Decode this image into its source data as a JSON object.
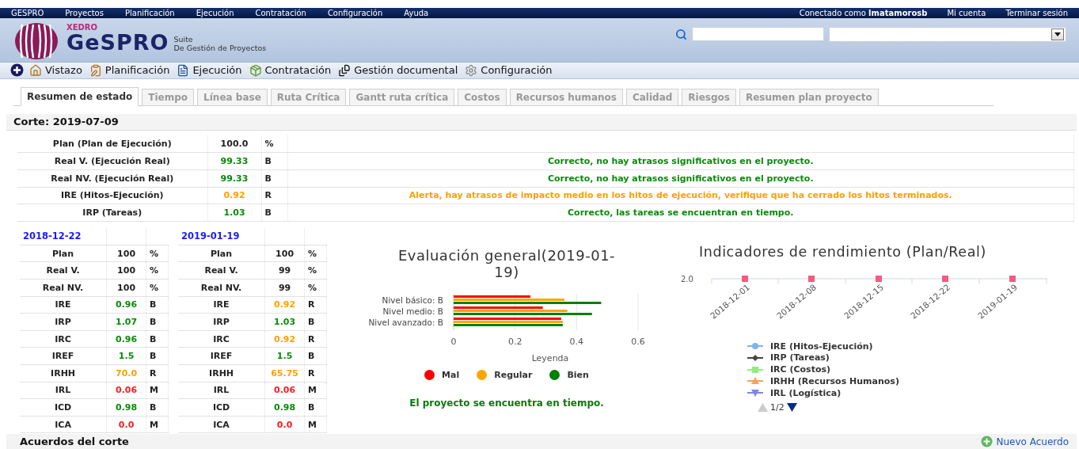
{
  "top_menu": {
    "items": [
      "GESPRO",
      "Proyectos",
      "Planificación",
      "Ejecución",
      "Contratación",
      "Configuración",
      "Ayuda"
    ],
    "user_prefix": "Conectado como",
    "user": "lmatamorosb",
    "links": [
      "Mi cuenta",
      "Terminar sesión"
    ]
  },
  "header": {
    "brand_small": "XEDRO",
    "brand": "GeSPRO",
    "suite": "Suite",
    "subtitle": "De Gestión de Proyectos"
  },
  "toolbar": [
    {
      "label": "Vistazo",
      "kind": "home"
    },
    {
      "label": "Planificación",
      "kind": "plan"
    },
    {
      "label": "Ejecución",
      "kind": "execution"
    },
    {
      "label": "Contratación",
      "kind": "contract"
    },
    {
      "label": "Gestión documental",
      "kind": "documents"
    },
    {
      "label": "Configuración",
      "kind": "settings"
    }
  ],
  "tabs": [
    {
      "label": "Resumen de estado",
      "selected": true
    },
    {
      "label": "Tiempo",
      "selected": false
    },
    {
      "label": "Línea base",
      "selected": false
    },
    {
      "label": "Ruta Crítica",
      "selected": false
    },
    {
      "label": "Gantt ruta crítica",
      "selected": false
    },
    {
      "label": "Costos",
      "selected": false
    },
    {
      "label": "Recursos humanos",
      "selected": false
    },
    {
      "label": "Calidad",
      "selected": false
    },
    {
      "label": "Riesgos",
      "selected": false
    },
    {
      "label": "Resumen plan proyecto",
      "selected": false
    }
  ],
  "cut": "Corte: 2019-07-09",
  "summary_rows": [
    {
      "label": "Plan (Plan de Ejecución)",
      "value": "100.0",
      "unit": "%",
      "color": "#222222"
    },
    {
      "label": "Real V. (Ejecución Real)",
      "value": "99.33",
      "unit": "B",
      "message": "Correcto, no hay atrasos significativos en el proyecto.",
      "color": "#0a8a0a"
    },
    {
      "label": "Real NV. (Ejecución Real)",
      "value": "99.33",
      "unit": "B",
      "message": "Correcto, no hay atrasos significativos en el proyecto.",
      "color": "#0a8a0a"
    },
    {
      "label": "IRE (Hitos-Ejecución)",
      "value": "0.92",
      "unit": "R",
      "message": "Alerta, hay atrasos de impacto medio en los hitos de ejecución, verifique que ha cerrado los hitos terminados.",
      "color": "#ffa000"
    },
    {
      "label": "IRP (Tareas)",
      "value": "1.03",
      "unit": "B",
      "message": "Correcto, las tareas se encuentran en tiempo.",
      "color": "#0a8a0a"
    }
  ],
  "period_tables": [
    {
      "date": "2018-12-22",
      "rows": [
        {
          "label": "Plan",
          "value": "100",
          "unit": "%",
          "color": "#222222"
        },
        {
          "label": "Real V.",
          "value": "100",
          "unit": "%",
          "color": "#222222"
        },
        {
          "label": "Real NV.",
          "value": "100",
          "unit": "%",
          "color": "#222222"
        },
        {
          "label": "IRE",
          "value": "0.96",
          "unit": "B",
          "color": "#0a8a0a"
        },
        {
          "label": "IRP",
          "value": "1.07",
          "unit": "B",
          "color": "#0a8a0a"
        },
        {
          "label": "IRC",
          "value": "0.96",
          "unit": "B",
          "color": "#0a8a0a"
        },
        {
          "label": "IREF",
          "value": "1.5",
          "unit": "B",
          "color": "#0a8a0a"
        },
        {
          "label": "IRHH",
          "value": "70.0",
          "unit": "R",
          "color": "#ffa000"
        },
        {
          "label": "IRL",
          "value": "0.06",
          "unit": "M",
          "color": "#ff1a1a"
        },
        {
          "label": "ICD",
          "value": "0.98",
          "unit": "B",
          "color": "#0a8a0a"
        },
        {
          "label": "ICA",
          "value": "0.0",
          "unit": "M",
          "color": "#ff1a1a"
        }
      ]
    },
    {
      "date": "2019-01-19",
      "rows": [
        {
          "label": "Plan",
          "value": "100",
          "unit": "%",
          "color": "#222222"
        },
        {
          "label": "Real V.",
          "value": "99",
          "unit": "%",
          "color": "#222222"
        },
        {
          "label": "Real NV.",
          "value": "99",
          "unit": "%",
          "color": "#222222"
        },
        {
          "label": "IRE",
          "value": "0.92",
          "unit": "R",
          "color": "#ffa000"
        },
        {
          "label": "IRP",
          "value": "1.03",
          "unit": "B",
          "color": "#0a8a0a"
        },
        {
          "label": "IRC",
          "value": "0.92",
          "unit": "R",
          "color": "#ffa000"
        },
        {
          "label": "IREF",
          "value": "1.5",
          "unit": "B",
          "color": "#0a8a0a"
        },
        {
          "label": "IRHH",
          "value": "65.75",
          "unit": "R",
          "color": "#ffa000"
        },
        {
          "label": "IRL",
          "value": "0.06",
          "unit": "M",
          "color": "#ff1a1a"
        },
        {
          "label": "ICD",
          "value": "0.98",
          "unit": "B",
          "color": "#0a8a0a"
        },
        {
          "label": "ICA",
          "value": "0.0",
          "unit": "M",
          "color": "#ff1a1a"
        }
      ]
    }
  ],
  "evaluation": {
    "chart_data": {
      "type": "bar",
      "orientation": "horizontal",
      "title": "Evaluación general(2019-01-19)",
      "xlabel": "Leyenda",
      "legend": "bottom",
      "categories": [
        "Nivel básico: B",
        "Nivel medio: B",
        "Nivel avanzado: B"
      ],
      "xlim": [
        0,
        0.6
      ],
      "xticks": [
        0,
        {
          "value": 0.2,
          "label": "0.2"
        },
        {
          "value": 0.4,
          "label": "0.4"
        },
        {
          "value": 0.6,
          "label": "0.6"
        }
      ],
      "series": [
        {
          "name": "Mal",
          "color": "#ff0000",
          "values": [
            0.25,
            0.29,
            0.35
          ]
        },
        {
          "name": "Regular",
          "color": "#ffa500",
          "values": [
            0.36,
            0.37,
            0.355
          ]
        },
        {
          "name": "Bien",
          "color": "#008000",
          "values": [
            0.48,
            0.45,
            0.355
          ]
        }
      ]
    },
    "message": "El proyecto se encuentra en tiempo."
  },
  "performance": {
    "title": "Indicadores de rendimiento (Plan/Real)",
    "y_tick": "2.0",
    "categories": [
      "2018-12-01",
      "2018-12-08",
      "2018-12-15",
      "2018-12-22",
      "2019-01-19"
    ],
    "legend": [
      {
        "name": "IRE (Hitos-Ejecución)",
        "color": "#7cb5ec",
        "kind": "circle"
      },
      {
        "name": "IRP (Tareas)",
        "color": "#434348",
        "kind": "diamond"
      },
      {
        "name": "IRC (Costos)",
        "color": "#90ed7d",
        "kind": "square"
      },
      {
        "name": "IRHH (Recursos Humanos)",
        "color": "#f7a35c",
        "kind": "triangle"
      },
      {
        "name": "IRL (Logística)",
        "color": "#8085e9",
        "kind": "triangle-down"
      }
    ],
    "pager": "1/2"
  },
  "agreements": {
    "title": "Acuerdos del corte",
    "new_button": "Nuevo Acuerdo"
  }
}
